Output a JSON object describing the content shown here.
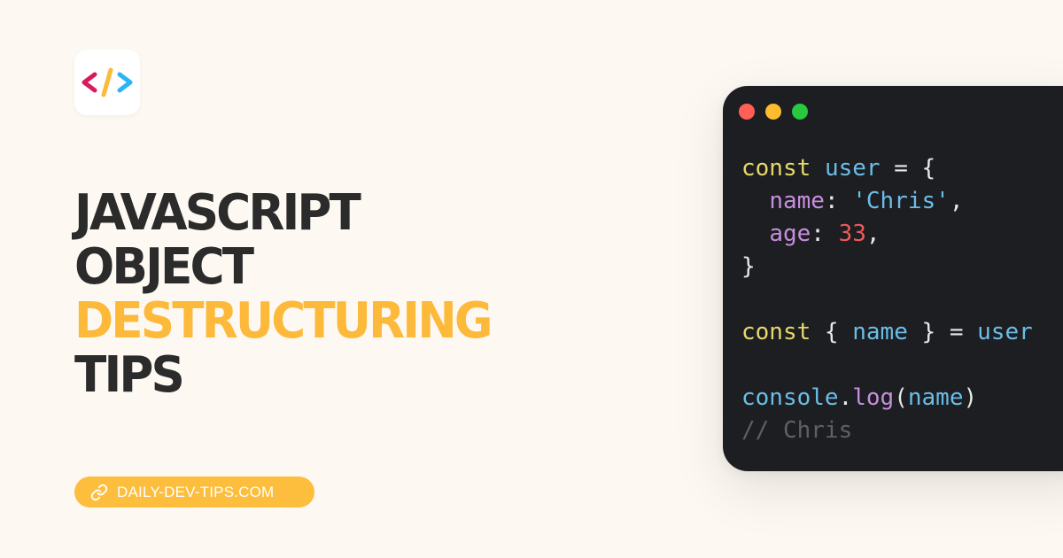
{
  "logo": {
    "icon": "code-brackets-icon",
    "colors": {
      "left_bracket": "#d81b60",
      "slash": "#fdb93a",
      "right_bracket": "#29b6f6"
    }
  },
  "title": {
    "line1": "JAVASCRIPT",
    "line2": "OBJECT",
    "line3": "DESTRUCTURING",
    "line4": "TIPS",
    "accent_color": "#fdb93a",
    "text_color": "#2b2b2b"
  },
  "link": {
    "icon": "link-icon",
    "text": "DAILY-DEV-TIPS.COM",
    "background": "#fdbe3d"
  },
  "code_window": {
    "background": "#1d1e21",
    "dots": [
      "#ff5f57",
      "#febc2e",
      "#28c840"
    ],
    "lines": {
      "l1": {
        "kw": "const",
        "name": "user",
        "rest": " = {"
      },
      "l2": {
        "prop": "name",
        "sep": ": ",
        "str": "'Chris'",
        "end": ","
      },
      "l3": {
        "prop": "age",
        "sep": ": ",
        "num": "33",
        "end": ","
      },
      "l4": {
        "text": "}"
      },
      "l6": {
        "kw": "const",
        "open": " { ",
        "name": "name",
        "close": " } = ",
        "target": "user"
      },
      "l8": {
        "obj": "console",
        "dot": ".",
        "fn": "log",
        "open": "(",
        "arg": "name",
        "close": ")"
      },
      "l9": {
        "comment": "// Chris"
      }
    }
  }
}
